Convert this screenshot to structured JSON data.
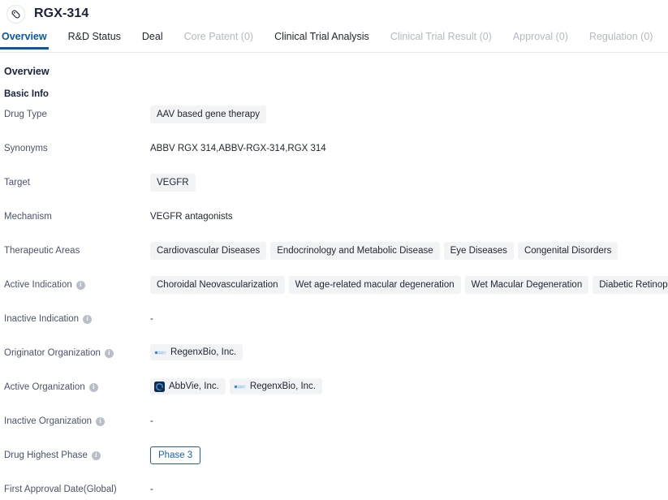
{
  "header": {
    "drug_name": "RGX-314",
    "avatar_icon": "capsule-pill-icon"
  },
  "tabs": [
    {
      "label": "Overview",
      "state": "active"
    },
    {
      "label": "R&D Status",
      "state": "enabled"
    },
    {
      "label": "Deal",
      "state": "enabled"
    },
    {
      "label": "Core Patent (0)",
      "state": "disabled"
    },
    {
      "label": "Clinical Trial Analysis",
      "state": "enabled"
    },
    {
      "label": "Clinical Trial Result (0)",
      "state": "disabled"
    },
    {
      "label": "Approval (0)",
      "state": "disabled"
    },
    {
      "label": "Regulation (0)",
      "state": "disabled"
    }
  ],
  "section": {
    "title": "Overview",
    "subsection": "Basic Info"
  },
  "rows": [
    {
      "label": "Drug Type",
      "info": false,
      "type": "tags",
      "values": [
        "AAV based gene therapy"
      ]
    },
    {
      "label": "Synonyms",
      "info": false,
      "type": "text",
      "values": [
        "ABBV RGX 314,ABBV-RGX-314,RGX 314"
      ]
    },
    {
      "label": "Target",
      "info": false,
      "type": "tags",
      "values": [
        "VEGFR"
      ]
    },
    {
      "label": "Mechanism",
      "info": false,
      "type": "text",
      "values": [
        "VEGFR antagonists"
      ]
    },
    {
      "label": "Therapeutic Areas",
      "info": false,
      "type": "tags",
      "values": [
        "Cardiovascular Diseases",
        "Endocrinology and Metabolic Disease",
        "Eye Diseases",
        "Congenital Disorders"
      ]
    },
    {
      "label": "Active Indication",
      "info": true,
      "type": "tags",
      "values": [
        "Choroidal Neovascularization",
        "Wet age-related macular degeneration",
        "Wet Macular Degeneration",
        "Diabetic Retinopathy"
      ]
    },
    {
      "label": "Inactive Indication",
      "info": true,
      "type": "empty",
      "values": [
        "-"
      ]
    },
    {
      "label": "Originator Organization",
      "info": true,
      "type": "orgs",
      "values": [
        {
          "name": "RegenxBio, Inc.",
          "logo": "regenxbio-logo"
        }
      ]
    },
    {
      "label": "Active Organization",
      "info": true,
      "type": "orgs",
      "values": [
        {
          "name": "AbbVie, Inc.",
          "logo": "abbvie-logo"
        },
        {
          "name": "RegenxBio, Inc.",
          "logo": "regenxbio-logo"
        }
      ]
    },
    {
      "label": "Inactive Organization",
      "info": true,
      "type": "empty",
      "values": [
        "-"
      ]
    },
    {
      "label": "Drug Highest Phase",
      "info": true,
      "type": "phase",
      "values": [
        "Phase 3"
      ]
    },
    {
      "label": "First Approval Date(Global)",
      "info": false,
      "type": "empty",
      "values": [
        "-"
      ]
    }
  ],
  "colors": {
    "accent": "#0a56a8",
    "phase_badge": "#1a5fb4",
    "label_text": "#49536b",
    "tag_bg": "#f2f3f5",
    "disabled_tab": "#b3b8c2"
  }
}
